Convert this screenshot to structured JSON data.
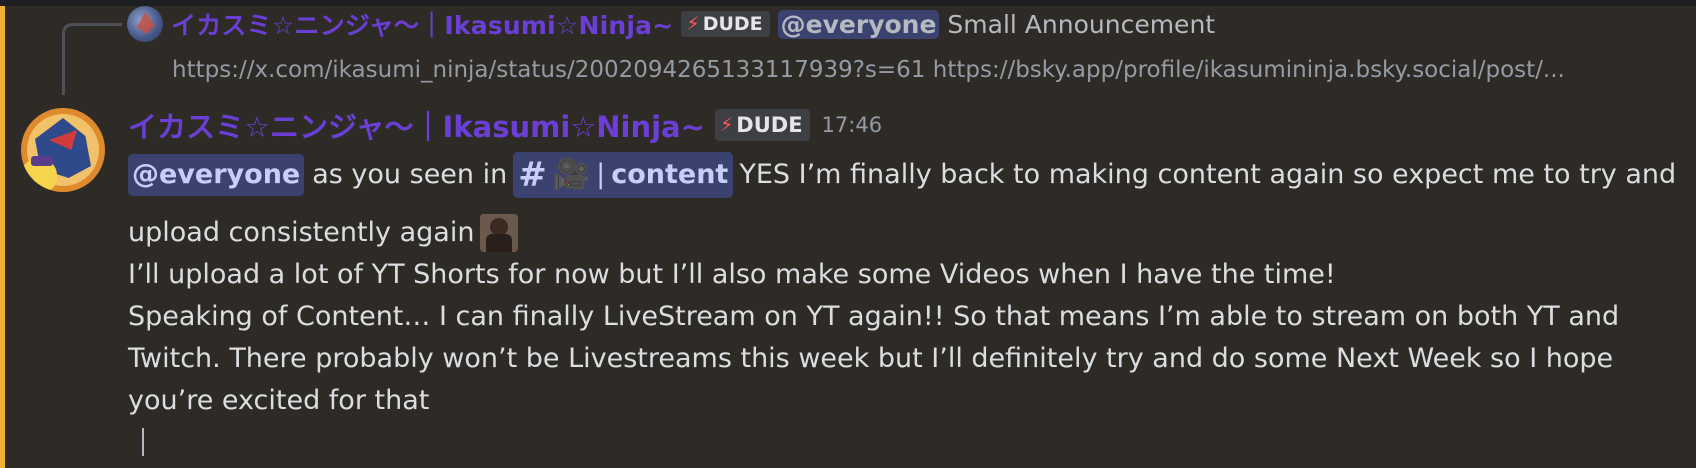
{
  "reply": {
    "author": "イカスミ☆ニンジャ〜｜Ikasumi☆Ninja~",
    "badge_icon": "⚡",
    "badge_label": "DUDE",
    "mention": "@everyone",
    "text": "Small Announcement",
    "links": "https://x.com/ikasumi_ninja/status/2002094265133117939?s=61 https://bsky.app/profile/ikasumininja.bsky.social/post/..."
  },
  "message": {
    "author": "イカスミ☆ニンジャ〜｜Ikasumi☆Ninja~",
    "badge_icon": "⚡",
    "badge_label": "DUDE",
    "timestamp": "17:46",
    "mention": "@everyone",
    "text_before_channel": "as you seen in",
    "channel_hash": "#",
    "channel_emoji": "🎥",
    "channel_sep": "|",
    "channel_name": "content",
    "text_after_channel": "YES I’m finally back to making content again so expect me to try and",
    "line2": "upload consistently again",
    "line3": "I’ll upload a lot of YT Shorts for now but I’ll also make some Videos when I have the time!",
    "line4": "Speaking of Content… I can finally LiveStream on YT again!! So that means I’m able to stream on both YT and",
    "line5": "Twitch. There probably won’t be Livestreams this week but I’ll definitely try and do some Next Week so I hope",
    "line6": "you’re excited for that"
  },
  "colors": {
    "background": "#2e2b27",
    "mention_highlight_bar": "#f0b132",
    "author": "#6b3fd6",
    "mention_bg": "#3c4270",
    "mention_fg": "#c9cdfb"
  }
}
